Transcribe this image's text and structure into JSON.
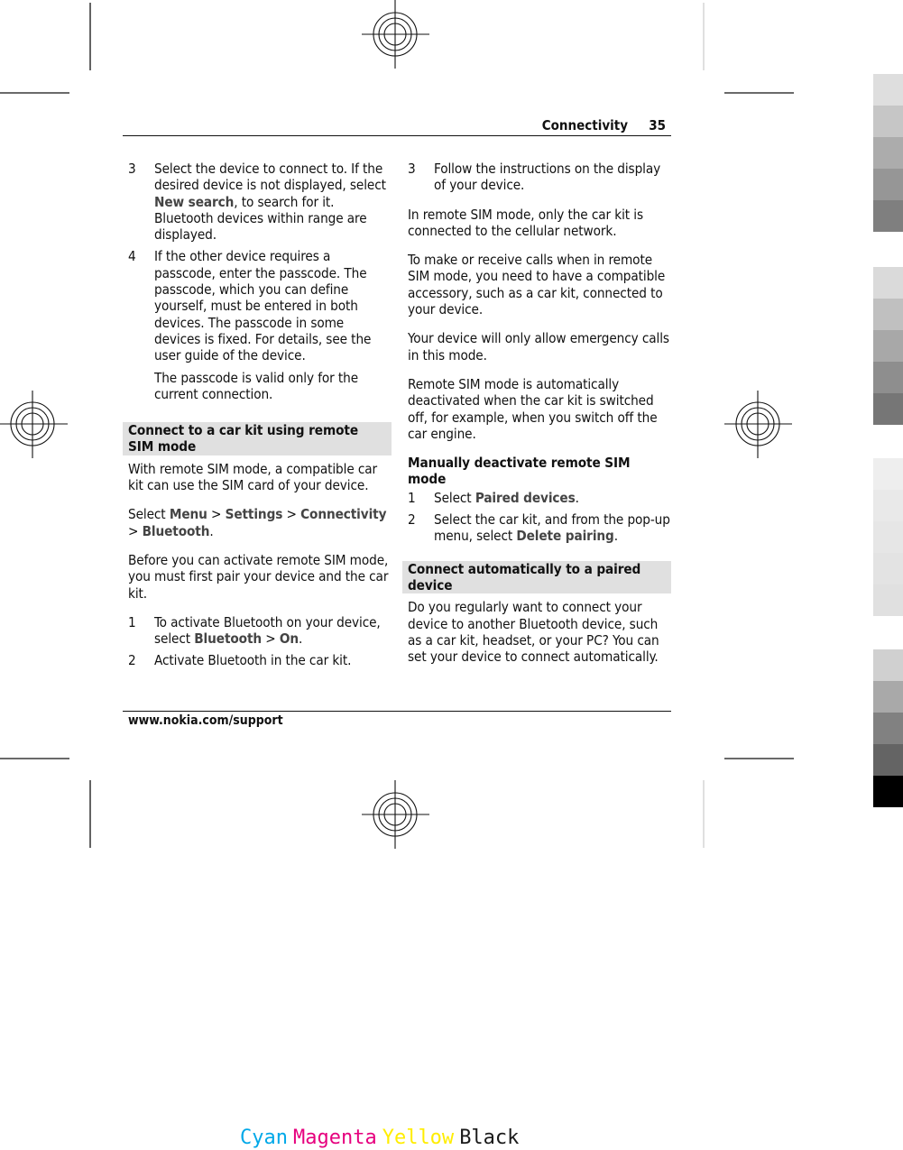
{
  "header": {
    "chapter": "Connectivity",
    "page_number": "35"
  },
  "left_column": {
    "step3": {
      "num": "3",
      "pre": "Select the device to connect to. If the desired device is not displayed, select ",
      "bold": "New search",
      "post": ", to search for it. Bluetooth devices within range are displayed."
    },
    "step4": {
      "num": "4",
      "text": "If the other device requires a passcode, enter the passcode. The passcode, which you can define yourself, must be entered in both devices. The passcode in some devices is fixed. For details, see the user guide of the device.",
      "note": "The passcode is valid only for the current connection."
    },
    "section_title": "Connect to a car kit using remote SIM mode",
    "intro": "With remote SIM mode, a compatible car kit can use the SIM card of your device.",
    "path": {
      "pre": "Select ",
      "menu": "Menu",
      "sep1": " > ",
      "settings": "Settings",
      "sep2": " > ",
      "connectivity": "Connectivity",
      "sep3": " > ",
      "bluetooth": "Bluetooth",
      "end": "."
    },
    "before": "Before you can activate remote SIM mode, you must first pair your device and the car kit.",
    "steps": [
      {
        "num": "1",
        "pre": "To activate Bluetooth on your device, select ",
        "bold1": "Bluetooth",
        "sep": " > ",
        "bold2": "On",
        "post": "."
      },
      {
        "num": "2",
        "text": "Activate Bluetooth in the car kit."
      }
    ]
  },
  "right_column": {
    "step3": {
      "num": "3",
      "text": "Follow the instructions on the display of your device."
    },
    "paragraphs": [
      "In remote SIM mode, only the car kit is connected to the cellular network.",
      "To make or receive calls when in remote SIM mode, you need to have a compatible accessory, such as a car kit, connected to your device.",
      "Your device will only allow emergency calls in this mode.",
      "Remote SIM mode is automatically deactivated when the car kit is switched off, for example, when you switch off the car engine."
    ],
    "subhead": "Manually deactivate remote SIM mode",
    "steps": [
      {
        "num": "1",
        "pre": "Select ",
        "bold": "Paired devices",
        "post": "."
      },
      {
        "num": "2",
        "pre": "Select the car kit, and from the pop-up menu, select ",
        "bold": "Delete pairing",
        "post": "."
      }
    ],
    "section_title": "Connect automatically to a paired device",
    "closing": "Do you regularly want to connect your device to another Bluetooth device, such as a car kit, headset, or your PC? You can set your device to connect automatically."
  },
  "footer": {
    "url": "www.nokia.com/support"
  },
  "color_bar": {
    "labels": [
      "Cyan",
      "Magenta",
      "Yellow",
      "Black"
    ],
    "colors": [
      "#00a8e8",
      "#e6007e",
      "#ffed00",
      "#1a1a1a"
    ]
  },
  "swatches": {
    "group1": [
      "#dedede",
      "#c6c6c6",
      "#acacac",
      "#969696",
      "#7f7f7f"
    ],
    "group2": [
      "#dadada",
      "#c0c0c0",
      "#a8a8a8",
      "#8e8e8e",
      "#767676"
    ],
    "group3": [
      "#eeeeee",
      "#e9e9e9",
      "#e6e6e6",
      "#e3e3e3",
      "#e0e0e0"
    ],
    "group4": [
      "#d0d0d0",
      "#a9a9a9",
      "#818181",
      "#646464",
      "#000000"
    ]
  }
}
